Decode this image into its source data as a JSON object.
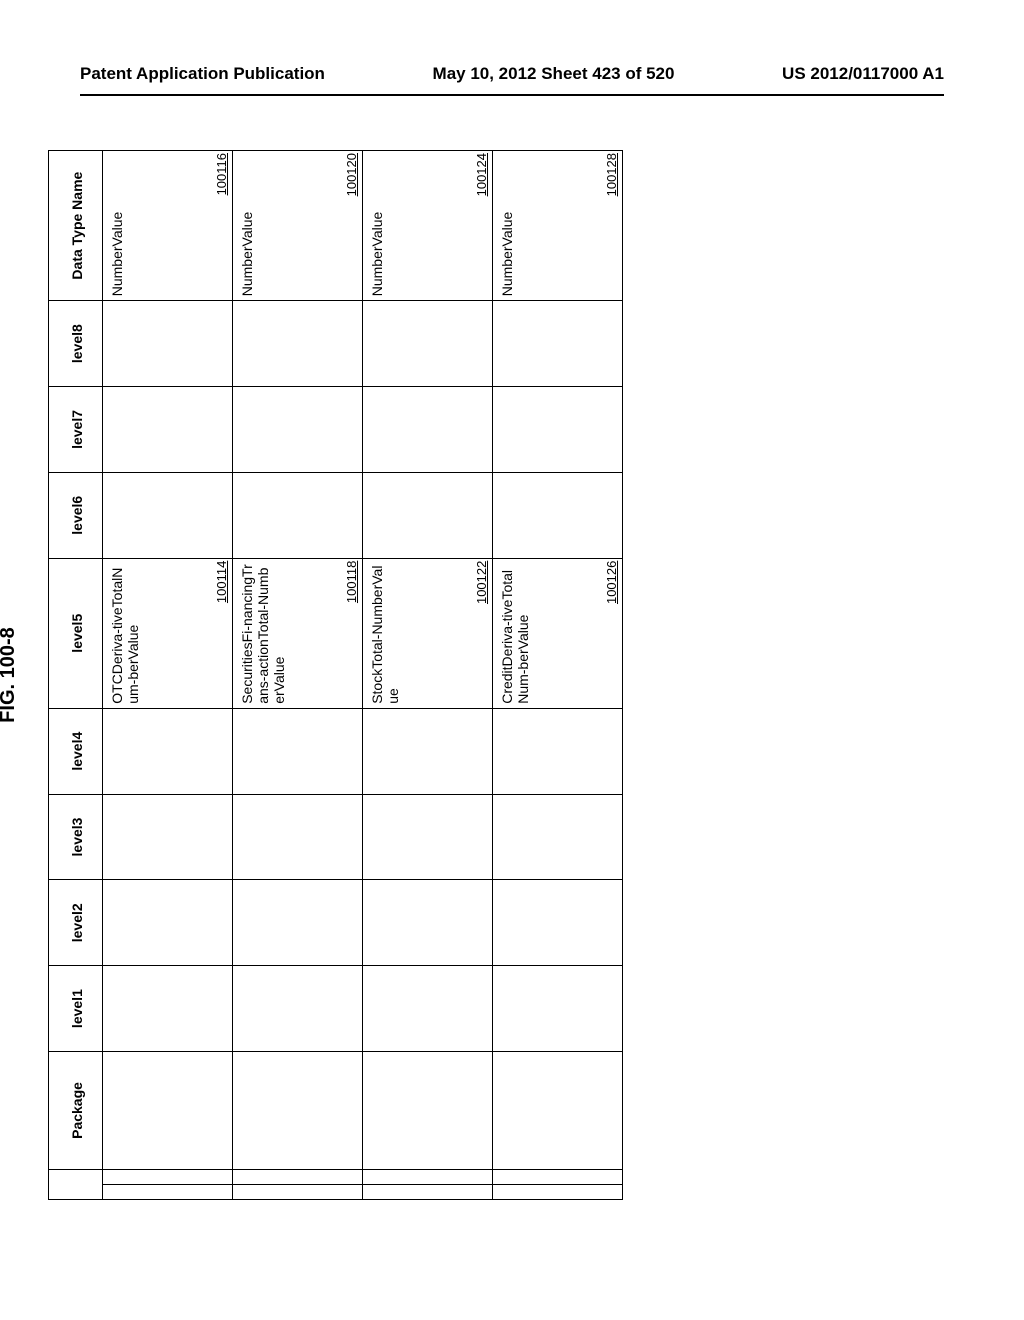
{
  "header": {
    "left": "Patent Application Publication",
    "center": "May 10, 2012  Sheet 423 of 520",
    "right": "US 2012/0117000 A1"
  },
  "figure_title": "FIG. 100-8",
  "columns": {
    "package": "Package",
    "level1": "level1",
    "level2": "level2",
    "level3": "level3",
    "level4": "level4",
    "level5": "level5",
    "level6": "level6",
    "level7": "level7",
    "level8": "level8",
    "data_type": "Data Type Name"
  },
  "rows": [
    {
      "level5_text": "OTCDeriva-tiveTotalNum-berValue",
      "level5_ref": "100114",
      "data_type_text": "NumberValue",
      "data_type_ref": "100116"
    },
    {
      "level5_text": "SecuritiesFi-nancingTrans-actionTotal-NumberValue",
      "level5_ref": "100118",
      "data_type_text": "NumberValue",
      "data_type_ref": "100120"
    },
    {
      "level5_text": "StockTotal-NumberValue",
      "level5_ref": "100122",
      "data_type_text": "NumberValue",
      "data_type_ref": "100124"
    },
    {
      "level5_text": "CreditDeriva-tiveTotalNum-berValue",
      "level5_ref": "100126",
      "data_type_text": "NumberValue",
      "data_type_ref": "100128"
    }
  ]
}
